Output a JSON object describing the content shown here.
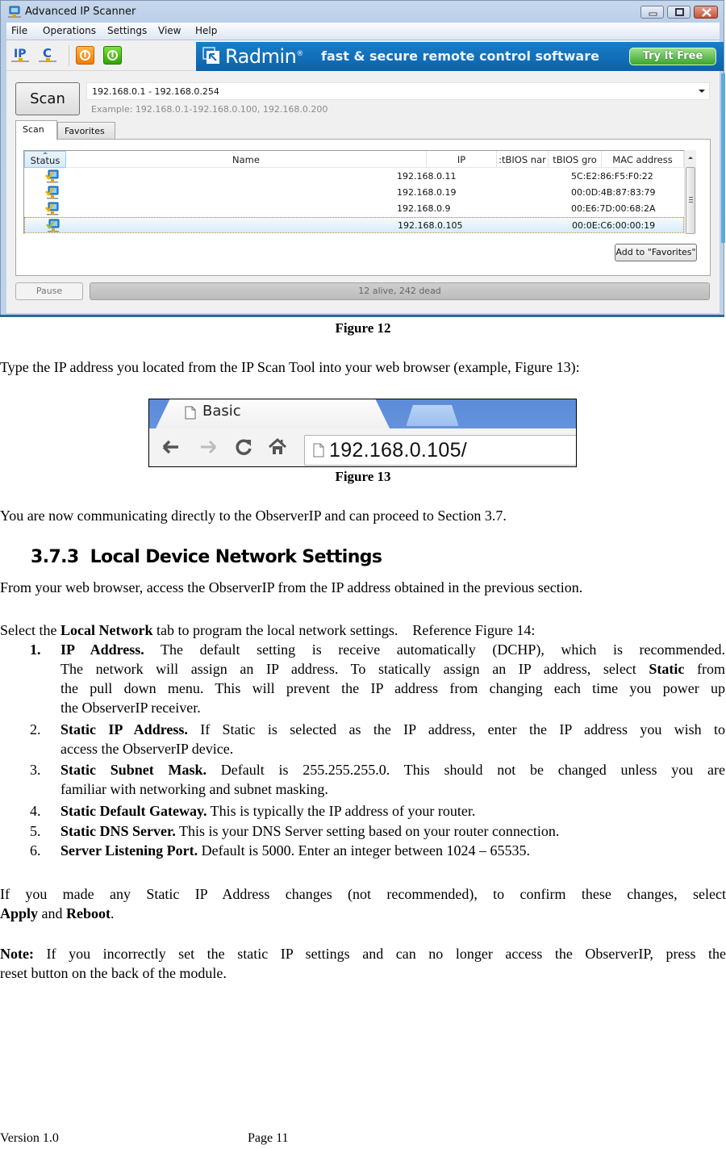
{
  "figure12": {
    "window_title": "Advanced IP Scanner",
    "window_controls": [
      "minimize",
      "maximize",
      "close"
    ],
    "menu": [
      "File",
      "Operations",
      "Settings",
      "View",
      "Help"
    ],
    "toolbar_icons": [
      "ip-icon",
      "c-class-icon",
      "power-orange-icon",
      "power-green-icon"
    ],
    "ad": {
      "brand": "Radmin",
      "tagline": "fast & secure remote control software",
      "cta": "Try It Free"
    },
    "scan_button": "Scan",
    "range_value": "192.168.0.1 - 192.168.0.254",
    "range_example": "Example: 192.168.0.1-192.168.0.100, 192.168.0.200",
    "tabs": [
      "Scan",
      "Favorites"
    ],
    "active_tab": "Scan",
    "columns": [
      "Status",
      "Name",
      "IP",
      ":tBIOS nar",
      "tBIOS gro",
      "MAC address"
    ],
    "rows": [
      {
        "status": "alive",
        "name": "",
        "ip": "192.168.0.11",
        "netbios_name": "",
        "netbios_group": "",
        "mac": "5C:E2:86:F5:F0:22",
        "selected": false
      },
      {
        "status": "alive",
        "name": "",
        "ip": "192.168.0.19",
        "netbios_name": "",
        "netbios_group": "",
        "mac": "00:0D:4B:87:83:79",
        "selected": false
      },
      {
        "status": "alive",
        "name": "",
        "ip": "192.168.0.9",
        "netbios_name": "",
        "netbios_group": "",
        "mac": "00:E6:7D:00:68:2A",
        "selected": false
      },
      {
        "status": "alive",
        "name": "",
        "ip": "192.168.0.105",
        "netbios_name": "",
        "netbios_group": "",
        "mac": "00:0E:C6:00:00:19",
        "selected": true
      }
    ],
    "add_favorites_button": "Add to \"Favorites\"",
    "pause_button": "Pause",
    "progress": {
      "text": "12 alive, 242 dead",
      "fraction": 1.0
    },
    "caption": "Figure 12"
  },
  "intro_text": "Type the IP address you located from the IP Scan Tool into your web browser (example, Figure 13):",
  "figure13": {
    "tab_title": "Basic",
    "url": "192.168.0.105/",
    "caption": "Figure 13"
  },
  "proceed_text": "You are now communicating directly to the ObserverIP and can proceed to Section 3.7.",
  "section": {
    "number": "3.7.3",
    "title": "Local Device Network Settings"
  },
  "section_intro": "From your web browser, access the ObserverIP from the IP address obtained in the previous section.",
  "select_line": {
    "pre": "Select the ",
    "bold": "Local Network",
    "post": " tab to program the local network settings.    Reference Figure 14:"
  },
  "items": [
    {
      "num": "1.",
      "title": "IP Address.",
      "line1": " The default setting is receive automatically (DCHP), which is recommended.",
      "line2_pre": "The network will assign an IP address. To statically assign an IP address, select ",
      "line2_bold": "Static",
      "line2_post": " from",
      "line3": "the pull down menu. This will prevent the IP address from changing each time you power up",
      "line4": "the ObserverIP receiver."
    },
    {
      "num": "2.",
      "title": "Static IP Address.",
      "line1": " If Static is selected as the IP address, enter the IP address you wish to",
      "line2": "access the ObserverIP device."
    },
    {
      "num": "3.",
      "title": "Static Subnet Mask.",
      "line1": " Default is 255.255.255.0. This should not be changed unless you are",
      "line2": "familiar with networking and subnet masking."
    },
    {
      "num": "4.",
      "title": "Static Default Gateway.",
      "line1": " This is typically the IP address of your router."
    },
    {
      "num": "5.",
      "title": "Static DNS Server.",
      "line1": " This is your DNS Server setting based on your router connection."
    },
    {
      "num": "6.",
      "title": "Server Listening Port.",
      "line1": " Default is 5000. Enter an integer between 1024 – 65535."
    }
  ],
  "apply_para": {
    "line1": "If you made any Static IP Address changes (not recommended), to confirm these changes, select",
    "bold1": "Apply",
    "mid": " and ",
    "bold2": "Reboot",
    "end": "."
  },
  "note_para": {
    "bold": "Note:",
    "line1": " If you incorrectly set the static IP settings and can no longer access the ObserverIP, press the",
    "line2": "reset button on the back of the module."
  },
  "footer": {
    "version": "Version 1.0",
    "page": "Page 11"
  }
}
